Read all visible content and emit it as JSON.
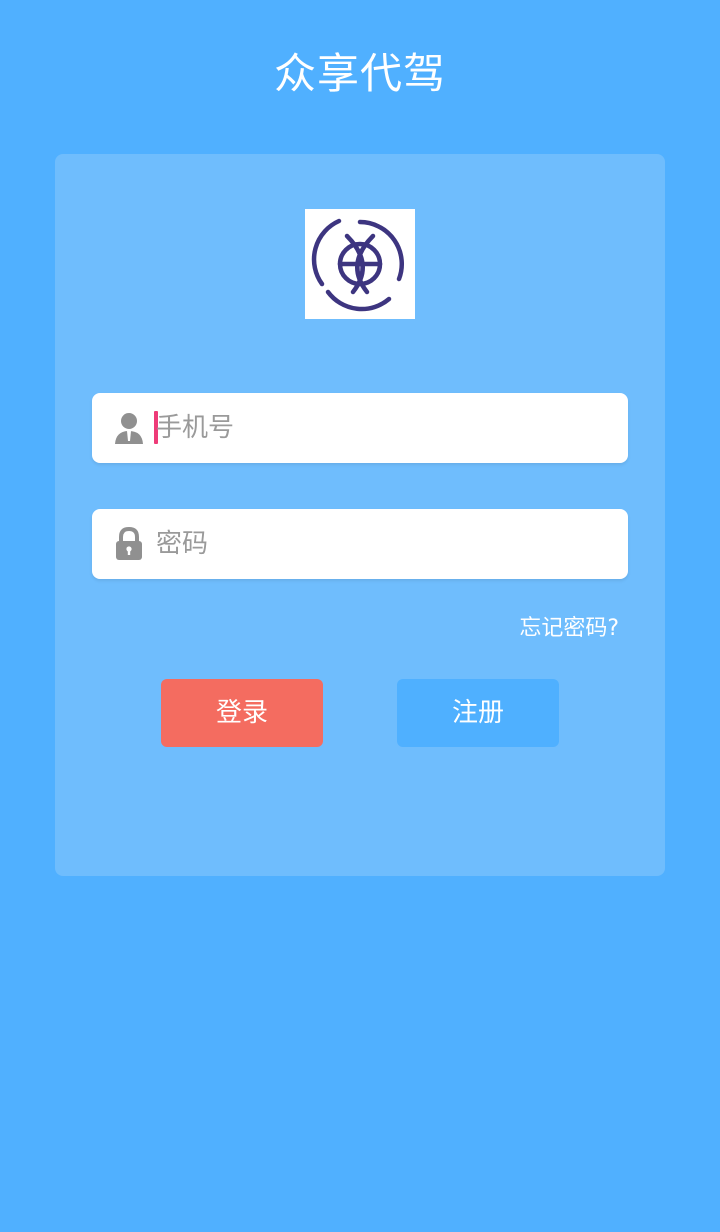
{
  "app": {
    "title": "众享代驾"
  },
  "colors": {
    "background": "#50b0ff",
    "card": "#6fbdfd",
    "login_button": "#f46c60",
    "register_button": "#4fb0ff",
    "logo_stroke": "#3d3580",
    "icon_gray": "#909090",
    "caret": "#ee3b78"
  },
  "login_form": {
    "logo_icon": "steering-wheel-logo",
    "phone": {
      "icon": "user-icon",
      "placeholder": "手机号",
      "value": ""
    },
    "password": {
      "icon": "lock-icon",
      "placeholder": "密码",
      "value": ""
    },
    "forgot_password": "忘记密码?",
    "login_button": "登录",
    "register_button": "注册"
  }
}
